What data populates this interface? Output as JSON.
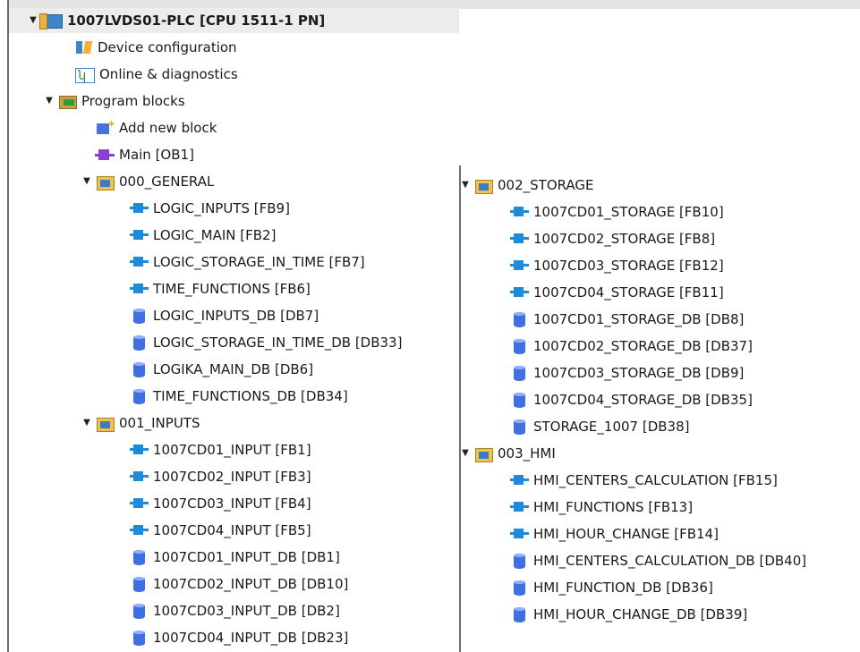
{
  "left_tree": [
    {
      "text": "1007LVDS01-PLC [CPU 1511-1 PN]",
      "icon": "cpu-icon",
      "arrow": "expanded",
      "bold": true
    },
    {
      "text": "Device configuration",
      "icon": "device-configuration-icon"
    },
    {
      "text": "Online & diagnostics",
      "icon": "online-diagnostics-icon"
    },
    {
      "text": "Program blocks",
      "icon": "program-blocks-folder-icon",
      "arrow": "expanded"
    },
    {
      "text": "Add new block",
      "icon": "add-block-icon"
    },
    {
      "text": "Main [OB1]",
      "icon": "ob-block-icon"
    },
    {
      "text": "000_GENERAL",
      "icon": "group-folder-icon",
      "arrow": "expanded"
    },
    {
      "text": "LOGIC_INPUTS [FB9]",
      "icon": "fb-block-icon"
    },
    {
      "text": "LOGIC_MAIN [FB2]",
      "icon": "fb-block-icon"
    },
    {
      "text": "LOGIC_STORAGE_IN_TIME [FB7]",
      "icon": "fb-block-icon"
    },
    {
      "text": "TIME_FUNCTIONS [FB6]",
      "icon": "fb-block-icon"
    },
    {
      "text": "LOGIC_INPUTS_DB [DB7]",
      "icon": "db-block-icon"
    },
    {
      "text": "LOGIC_STORAGE_IN_TIME_DB [DB33]",
      "icon": "db-block-icon"
    },
    {
      "text": "LOGIKA_MAIN_DB [DB6]",
      "icon": "db-block-icon"
    },
    {
      "text": "TIME_FUNCTIONS_DB [DB34]",
      "icon": "db-block-icon"
    },
    {
      "text": "001_INPUTS",
      "icon": "group-folder-icon",
      "arrow": "expanded"
    },
    {
      "text": "1007CD01_INPUT [FB1]",
      "icon": "fb-block-icon"
    },
    {
      "text": "1007CD02_INPUT [FB3]",
      "icon": "fb-block-icon"
    },
    {
      "text": "1007CD03_INPUT [FB4]",
      "icon": "fb-block-icon"
    },
    {
      "text": "1007CD04_INPUT [FB5]",
      "icon": "fb-block-icon"
    },
    {
      "text": "1007CD01_INPUT_DB [DB1]",
      "icon": "db-block-icon"
    },
    {
      "text": "1007CD02_INPUT_DB [DB10]",
      "icon": "db-block-icon"
    },
    {
      "text": "1007CD03_INPUT_DB [DB2]",
      "icon": "db-block-icon"
    },
    {
      "text": "1007CD04_INPUT_DB [DB23]",
      "icon": "db-block-icon"
    }
  ],
  "right_tree": [
    {
      "text": "002_STORAGE",
      "icon": "group-folder-icon",
      "arrow": "expanded"
    },
    {
      "text": "1007CD01_STORAGE [FB10]",
      "icon": "fb-block-icon"
    },
    {
      "text": "1007CD02_STORAGE [FB8]",
      "icon": "fb-block-icon"
    },
    {
      "text": "1007CD03_STORAGE [FB12]",
      "icon": "fb-block-icon"
    },
    {
      "text": "1007CD04_STORAGE [FB11]",
      "icon": "fb-block-icon"
    },
    {
      "text": "1007CD01_STORAGE_DB [DB8]",
      "icon": "db-block-icon"
    },
    {
      "text": "1007CD02_STORAGE_DB [DB37]",
      "icon": "db-block-icon"
    },
    {
      "text": "1007CD03_STORAGE_DB [DB9]",
      "icon": "db-block-icon"
    },
    {
      "text": "1007CD04_STORAGE_DB [DB35]",
      "icon": "db-block-icon"
    },
    {
      "text": "STORAGE_1007 [DB38]",
      "icon": "db-block-icon"
    },
    {
      "text": "003_HMI",
      "icon": "group-folder-icon",
      "arrow": "expanded"
    },
    {
      "text": "HMI_CENTERS_CALCULATION [FB15]",
      "icon": "fb-block-icon"
    },
    {
      "text": "HMI_FUNCTIONS [FB13]",
      "icon": "fb-block-icon"
    },
    {
      "text": "HMI_HOUR_CHANGE [FB14]",
      "icon": "fb-block-icon"
    },
    {
      "text": "HMI_CENTERS_CALCULATION_DB [DB40]",
      "icon": "db-block-icon"
    },
    {
      "text": "HMI_FUNCTION_DB [DB36]",
      "icon": "db-block-icon"
    },
    {
      "text": "HMI_HOUR_CHANGE_DB [DB39]",
      "icon": "db-block-icon"
    }
  ],
  "colors": {
    "fb": "#1f8ad8",
    "db": "#3f6fe0",
    "ob": "#8b3fd0",
    "folder": "#f0c24b"
  }
}
